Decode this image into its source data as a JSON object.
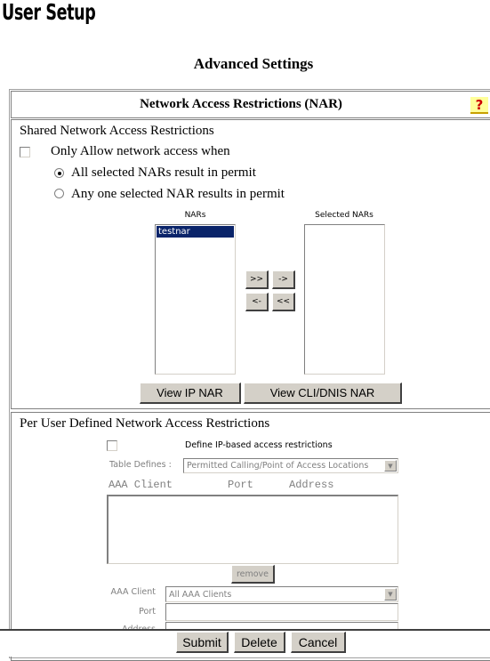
{
  "page_title": "User Setup",
  "section_title": "Advanced Settings",
  "nar": {
    "header": "Network Access Restrictions (NAR)",
    "help_icon": "question-mark-icon",
    "shared": {
      "title": "Shared Network Access Restrictions",
      "only_allow_label": "Only Allow network access when",
      "only_allow_checked": false,
      "radio_all": "All selected NARs result in permit",
      "radio_any": "Any one selected NAR results in permit",
      "radio_selected": "all",
      "nars_label": "NARs",
      "nars_items": [
        "testnar"
      ],
      "selected_nars_label": "Selected NARs",
      "selected_nars_items": [],
      "btn_add_all": ">>",
      "btn_add": "->",
      "btn_remove": "<-",
      "btn_remove_all": "<<",
      "view_ip": "View IP NAR",
      "view_cli": "View CLI/DNIS NAR"
    },
    "per_user": {
      "title": "Per User Defined Network Access Restrictions",
      "define_label": "Define IP-based access restrictions",
      "define_checked": false,
      "table_defines_label": "Table Defines :",
      "table_defines_value": "Permitted Calling/Point of Access Locations",
      "col_client": "AAA Client",
      "col_port": "Port",
      "col_address": "Address",
      "remove": "remove",
      "client_label": "AAA Client",
      "client_value": "All AAA Clients",
      "port_label": "Port",
      "port_value": "",
      "address_label": "Address",
      "address_value": ""
    }
  },
  "footer": {
    "submit": "Submit",
    "delete": "Delete",
    "cancel": "Cancel"
  }
}
